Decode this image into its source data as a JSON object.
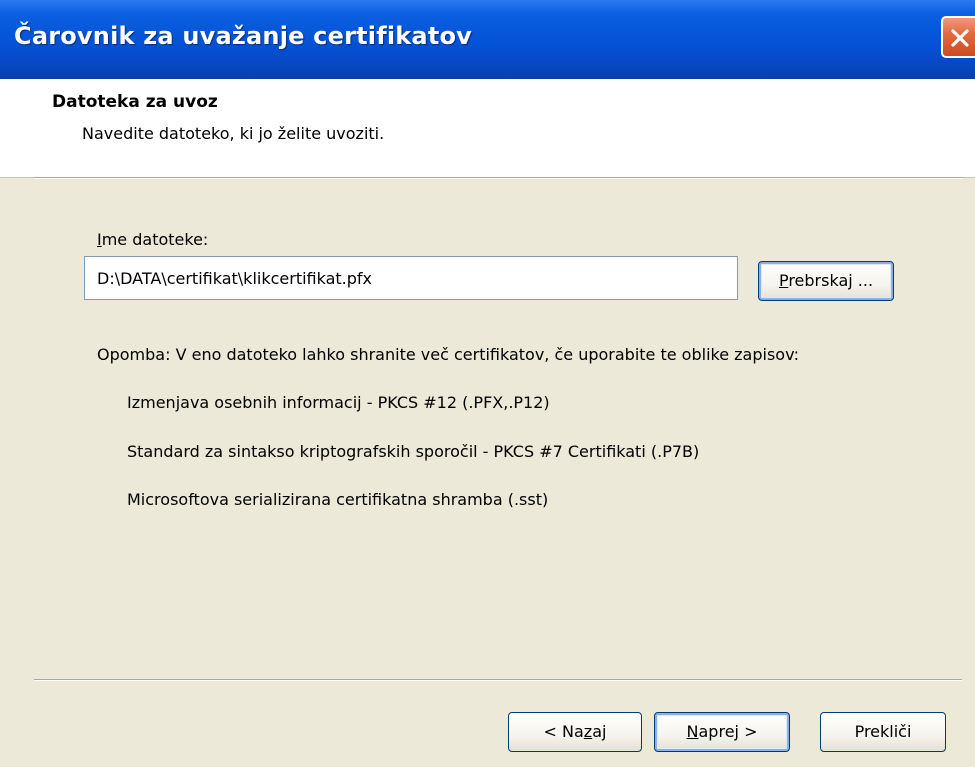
{
  "window": {
    "title": "Čarovnik za uvažanje certifikatov"
  },
  "header": {
    "title": "Datoteka za uvoz",
    "subtitle": "Navedite datoteko, ki jo želite uvoziti."
  },
  "form": {
    "filename_label": "Ime datoteke:",
    "filename_value": "D:\\DATA\\certifikat\\klikcertifikat.pfx",
    "browse_label": "Prebrskaj ..."
  },
  "note": {
    "text": "Opomba: V eno datoteko lahko shranite več certifikatov, če uporabite te oblike zapisov:",
    "formats": [
      "Izmenjava osebnih informacij - PKCS #12 (.PFX,.P12)",
      "Standard za sintakso kriptografskih sporočil - PKCS #7 Certifikati (.P7B)",
      "Microsoftova serializirana certifikatna shramba (.sst)"
    ]
  },
  "buttons": {
    "back": "< Nazaj",
    "next": "Naprej >",
    "cancel": "Prekliči"
  },
  "icons": {
    "close": "close-icon"
  },
  "colors": {
    "titlebar": "#0552d6",
    "dialog_bg": "#ece9d8",
    "close_button": "#e36b41"
  }
}
